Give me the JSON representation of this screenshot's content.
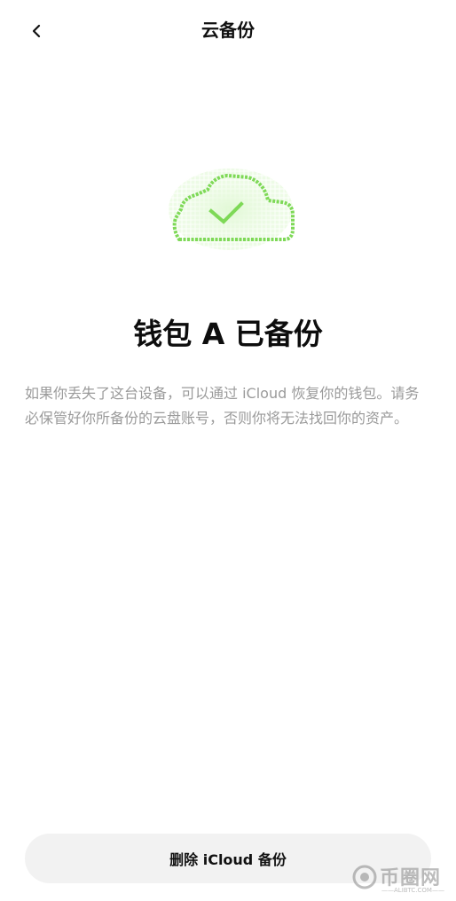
{
  "header": {
    "title": "云备份",
    "back_icon": "chevron-left-icon"
  },
  "illustration": {
    "icon": "cloud-check-icon",
    "accent_color": "#7ed957"
  },
  "main": {
    "title": "钱包 A 已备份",
    "description": "如果你丢失了这台设备，可以通过 iCloud 恢复你的钱包。请务必保管好你所备份的云盘账号，否则你将无法找回你的资产。"
  },
  "footer": {
    "delete_button_label": "删除 iCloud 备份"
  },
  "watermark": {
    "brand_text": "币圈网",
    "url_text": "——ALIBTC.COM——"
  }
}
